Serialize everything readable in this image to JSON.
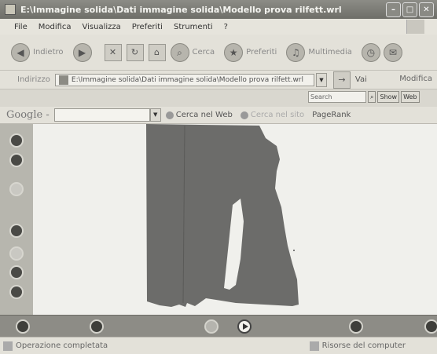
{
  "window": {
    "title": "E:\\Immagine solida\\Dati immagine solida\\Modello prova rilfett.wrl"
  },
  "menu": [
    "File",
    "Modifica",
    "Visualizza",
    "Preferiti",
    "Strumenti",
    "?"
  ],
  "toolbar": {
    "back": "Indietro",
    "search": "Cerca",
    "favorites": "Preferiti",
    "multimedia": "Multimedia"
  },
  "address": {
    "label": "Indirizzo",
    "value": "E:\\Immagine solida\\Dati immagine solida\\Modello prova rilfett.wrl",
    "go": "Vai",
    "modify": "Modifica"
  },
  "search_widget": {
    "placeholder": "Search",
    "button_show": "Show",
    "button_web": "Web"
  },
  "google": {
    "logo": "Google -",
    "search_web": "Cerca nel Web",
    "search_site": "Cerca nel sito",
    "pagerank": "PageRank"
  },
  "status": {
    "left": "Operazione completata",
    "right": "Risorse del computer"
  },
  "colors": {
    "titlebar": "#7a7a74",
    "shape": "#6c6c6a",
    "panel": "#b7b6ae"
  }
}
